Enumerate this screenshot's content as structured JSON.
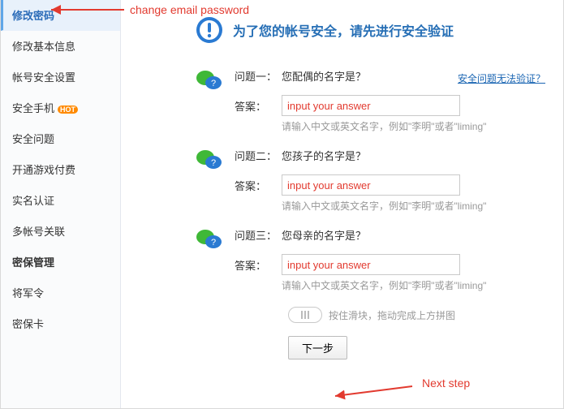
{
  "sidebar": {
    "items": [
      {
        "label": "修改密码",
        "selected": true
      },
      {
        "label": "修改基本信息"
      },
      {
        "label": "帐号安全设置"
      },
      {
        "label": "安全手机",
        "hot": "HOT"
      },
      {
        "label": "安全问题"
      },
      {
        "label": "开通游戏付费"
      },
      {
        "label": "实名认证"
      },
      {
        "label": "多帐号关联"
      },
      {
        "label": "密保管理",
        "bold": true
      },
      {
        "label": "将军令"
      },
      {
        "label": "密保卡"
      }
    ]
  },
  "header": {
    "title": "为了您的帐号安全，请先进行安全验证"
  },
  "help_link": "安全问题无法验证？",
  "questions": [
    {
      "q_label": "问题一：",
      "q_text": "您配偶的名字是？",
      "a_label": "答案：",
      "placeholder": "input your answer",
      "hint": "请输入中文或英文名字，例如\"李明\"或者\"liming\""
    },
    {
      "q_label": "问题二：",
      "q_text": "您孩子的名字是？",
      "a_label": "答案：",
      "placeholder": "input your answer",
      "hint": "请输入中文或英文名字，例如\"李明\"或者\"liming\""
    },
    {
      "q_label": "问题三：",
      "q_text": "您母亲的名字是？",
      "a_label": "答案：",
      "placeholder": "input your answer",
      "hint": "请输入中文或英文名字，例如\"李明\"或者\"liming\""
    }
  ],
  "slider": {
    "text": "按住滑块，拖动完成上方拼图"
  },
  "next_button": "下一步",
  "annotations": {
    "change_pw": "change email password",
    "next_step": "Next step"
  }
}
